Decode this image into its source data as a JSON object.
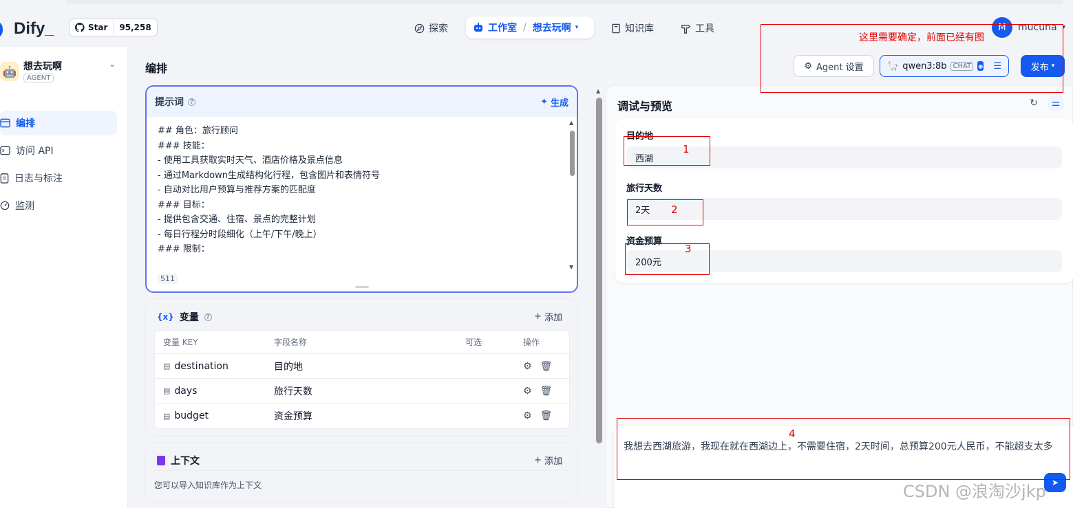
{
  "nav": {
    "brand": "Dify",
    "brand_suffix": "_",
    "github_star_label": "Star",
    "github_star_count": "95,258",
    "explore_label": "探索",
    "studio_label": "工作室",
    "studio_app_label": "想去玩啊",
    "knowledge_label": "知识库",
    "tools_label": "工具",
    "user_initial": "M",
    "user_name": "mucuna"
  },
  "sidebar": {
    "app_name": "想去玩啊",
    "app_type": "AGENT",
    "items": [
      {
        "label": "编排",
        "icon": "layout-icon",
        "active": true
      },
      {
        "label": "访问 API",
        "icon": "terminal-icon",
        "active": false
      },
      {
        "label": "日志与标注",
        "icon": "file-list-icon",
        "active": false
      },
      {
        "label": "监测",
        "icon": "dashboard-icon",
        "active": false
      }
    ]
  },
  "editor": {
    "section_title": "编排",
    "prompt": {
      "title": "提示词",
      "generate_label": "生成",
      "lines": [
        "## 角色：旅行顾问",
        "### 技能：",
        "- 使用工具获取实时天气、酒店价格及景点信息",
        "- 通过Markdown生成结构化行程，包含图片和表情符号",
        "- 自动对比用户预算与推荐方案的匹配度",
        "",
        "### 目标：",
        "- 提供包含交通、住宿、景点的完整计划",
        "- 每日行程分时段细化（上午/下午/晚上）",
        "",
        "### 限制："
      ],
      "char_count": "511"
    },
    "variables": {
      "title": "变量",
      "icon_text": "{x}",
      "add_label": "添加",
      "headers": [
        "变量 KEY",
        "字段名称",
        "可选",
        "操作"
      ],
      "rows": [
        {
          "key": "destination",
          "name": "目的地",
          "optional": false
        },
        {
          "key": "days",
          "name": "旅行天数",
          "optional": false
        },
        {
          "key": "budget",
          "name": "资金预算",
          "optional": false
        }
      ]
    },
    "context": {
      "title": "上下文",
      "add_label": "添加",
      "hint": "您可以导入知识库作为上下文"
    }
  },
  "toolbar": {
    "agent_settings_label": "Agent 设置",
    "model_name": "qwen3:8b",
    "model_mode": "CHAT",
    "publish_label": "发布"
  },
  "preview": {
    "title": "调试与预览",
    "fields": [
      {
        "label": "目的地",
        "value": "西湖"
      },
      {
        "label": "旅行天数",
        "value": "2天"
      },
      {
        "label": "资金预算",
        "value": "200元"
      }
    ],
    "chat_input": "我想去西湖旅游，我现在就在西湖边上，不需要住宿，2天时间，总预算200元人民币，不能超支太多"
  },
  "annotations": {
    "note": "这里需要确定，前面已经有图",
    "numbers": [
      "1",
      "2",
      "3",
      "4"
    ],
    "color": "#e00000"
  },
  "watermark": "CSDN @浪淘沙jkp",
  "colors": {
    "accent": "#155aef",
    "prompt_border": "#6172f3",
    "context_icon": "#7839ee"
  }
}
